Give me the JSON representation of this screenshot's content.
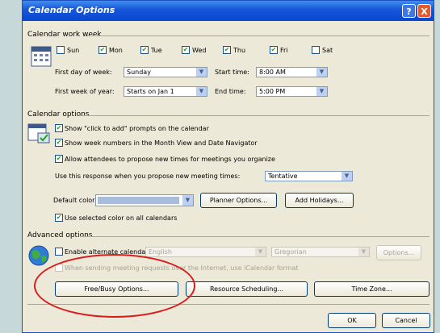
{
  "dialog": {
    "title": "Calendar Options",
    "help_label": "?",
    "close_label": "X"
  },
  "work_week": {
    "section_label": "Calendar work week",
    "days": [
      {
        "label": "Sun",
        "checked": false
      },
      {
        "label": "Mon",
        "checked": true
      },
      {
        "label": "Tue",
        "checked": true
      },
      {
        "label": "Wed",
        "checked": true
      },
      {
        "label": "Thu",
        "checked": true
      },
      {
        "label": "Fri",
        "checked": true
      },
      {
        "label": "Sat",
        "checked": false
      }
    ],
    "first_day_label": "First day of week:",
    "first_day_value": "Sunday",
    "start_time_label": "Start time:",
    "start_time_value": "8:00 AM",
    "first_week_label": "First week of year:",
    "first_week_value": "Starts on Jan 1",
    "end_time_label": "End time:",
    "end_time_value": "5:00 PM"
  },
  "calendar_options": {
    "section_label": "Calendar options",
    "click_to_add": "Show \"click to add\" prompts on the calendar",
    "week_numbers": "Show week numbers in the Month View and Date Navigator",
    "allow_propose": "Allow attendees to propose new times for meetings you organize",
    "propose_response_label": "Use this response when you propose new meeting times:",
    "propose_response_value": "Tentative",
    "default_color_label": "Default color:",
    "planner_button": "Planner Options...",
    "holidays_button": "Add Holidays...",
    "use_selected_color": "Use selected color on all calendars"
  },
  "advanced_options": {
    "section_label": "Advanced options",
    "alt_calendar_label": "Enable alternate calendar",
    "alt_calendar_lang": "English",
    "alt_calendar_type": "Gregorian",
    "options_button": "Options...",
    "internet_note": "When sending meeting requests over the Internet, use iCalendar format",
    "freebusy_button": "Free/Busy Options...",
    "resource_button": "Resource Scheduling...",
    "timezone_button": "Time Zone..."
  },
  "footer": {
    "ok_label": "OK",
    "cancel_label": "Cancel"
  },
  "colors": {
    "title_bar": "#0a47d0",
    "dialog_bg": "#ece9d8",
    "annotation": "#d81c1c",
    "check": "#21a121"
  }
}
